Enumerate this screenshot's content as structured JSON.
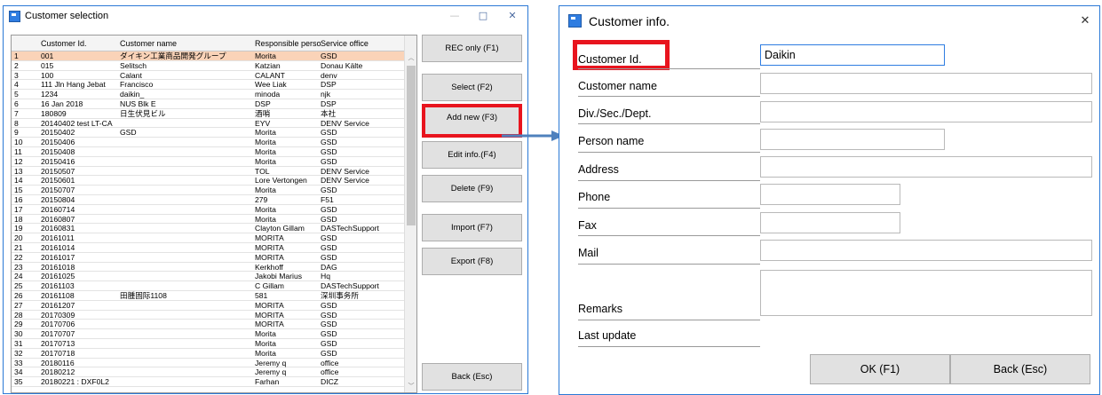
{
  "customer_selection": {
    "title": "Customer selection",
    "columns": [
      "Customer Id.",
      "Customer name",
      "Responsible person",
      "Service office"
    ],
    "rows": [
      [
        "1",
        "001",
        "ダイキン工業商品開発グループ",
        "Morita",
        "GSD"
      ],
      [
        "2",
        "015",
        "Selitsch",
        "Katzian",
        "Donau Kälte"
      ],
      [
        "3",
        "100",
        "Calant",
        "CALANT",
        "denv"
      ],
      [
        "4",
        "111 Jln Hang Jebat",
        "Francisco",
        "Wee Liak",
        "DSP"
      ],
      [
        "5",
        "1234",
        "daikin_",
        "minoda",
        "njk"
      ],
      [
        "6",
        "16 Jan 2018",
        "NUS Blk E",
        "DSP",
        "DSP"
      ],
      [
        "7",
        "180809",
        "日生伏見ビル",
        "酒哨",
        "本社"
      ],
      [
        "8",
        "20140402 test LT-CA",
        "",
        "EYV",
        "DENV Service"
      ],
      [
        "9",
        "20150402",
        "GSD",
        "Morita",
        "GSD"
      ],
      [
        "10",
        "20150406",
        "",
        "Morita",
        "GSD"
      ],
      [
        "11",
        "20150408",
        "",
        "Morita",
        "GSD"
      ],
      [
        "12",
        "20150416",
        "",
        "Morita",
        "GSD"
      ],
      [
        "13",
        "20150507",
        "",
        "TOL",
        "DENV Service"
      ],
      [
        "14",
        "20150601",
        "",
        "Lore Vertongen",
        "DENV Service"
      ],
      [
        "15",
        "20150707",
        "",
        "Morita",
        "GSD"
      ],
      [
        "16",
        "20150804",
        "",
        "279",
        "F51"
      ],
      [
        "17",
        "20160714",
        "",
        "Morita",
        "GSD"
      ],
      [
        "18",
        "20160807",
        "",
        "Morita",
        "GSD"
      ],
      [
        "19",
        "20160831",
        "",
        "Clayton Gillam",
        "DASTechSupport"
      ],
      [
        "20",
        "20161011",
        "",
        "MORITA",
        "GSD"
      ],
      [
        "21",
        "20161014",
        "",
        "MORITA",
        "GSD"
      ],
      [
        "22",
        "20161017",
        "",
        "MORITA",
        "GSD"
      ],
      [
        "23",
        "20161018",
        "",
        "Kerkhoff",
        "DAG"
      ],
      [
        "24",
        "20161025",
        "",
        "Jakobi Marius",
        "Hq"
      ],
      [
        "25",
        "20161103",
        "",
        "C Gillam",
        "DASTechSupport"
      ],
      [
        "26",
        "20161108",
        "田腫固际1108",
        "581",
        "深圳事务所"
      ],
      [
        "27",
        "20161207",
        "",
        "MORITA",
        "GSD"
      ],
      [
        "28",
        "20170309",
        "",
        "MORITA",
        "GSD"
      ],
      [
        "29",
        "20170706",
        "",
        "MORITA",
        "GSD"
      ],
      [
        "30",
        "20170707",
        "",
        "Morita",
        "GSD"
      ],
      [
        "31",
        "20170713",
        "",
        "Morita",
        "GSD"
      ],
      [
        "32",
        "20170718",
        "",
        "Morita",
        "GSD"
      ],
      [
        "33",
        "20180116",
        "",
        "Jeremy q",
        "office"
      ],
      [
        "34",
        "20180212",
        "",
        "Jeremy q",
        "office"
      ],
      [
        "35",
        "20180221 : DXF0L2",
        "",
        "Farhan",
        "DICZ"
      ]
    ],
    "buttons": {
      "rec_only": "REC only (F1)",
      "select": "Select (F2)",
      "add_new": "Add new (F3)",
      "edit_info": "Edit info.(F4)",
      "delete": "Delete (F9)",
      "import": "Import (F7)",
      "export": "Export (F8)",
      "back": "Back (Esc)"
    },
    "window_controls": {
      "minimize": "—",
      "maximize": "□",
      "close": "✕"
    }
  },
  "customer_info": {
    "title": "Customer info.",
    "close": "✕",
    "labels": {
      "customer_id": "Customer Id.",
      "customer_name": "Customer name",
      "div": "Div./Sec./Dept.",
      "person": "Person name",
      "address": "Address",
      "phone": "Phone",
      "fax": "Fax",
      "mail": "Mail",
      "remarks": "Remarks",
      "last_update": "Last update"
    },
    "values": {
      "customer_id": "Daikin",
      "customer_name": "",
      "div": "",
      "person": "",
      "address": "",
      "phone": "",
      "fax": "",
      "mail": "",
      "remarks": ""
    },
    "buttons": {
      "ok": "OK (F1)",
      "back": "Back (Esc)"
    }
  },
  "colors": {
    "highlight_red": "#e8141e",
    "selected_row": "#fad3b8",
    "arrow_blue": "#4f81bd",
    "window_border": "#2b79d6"
  }
}
